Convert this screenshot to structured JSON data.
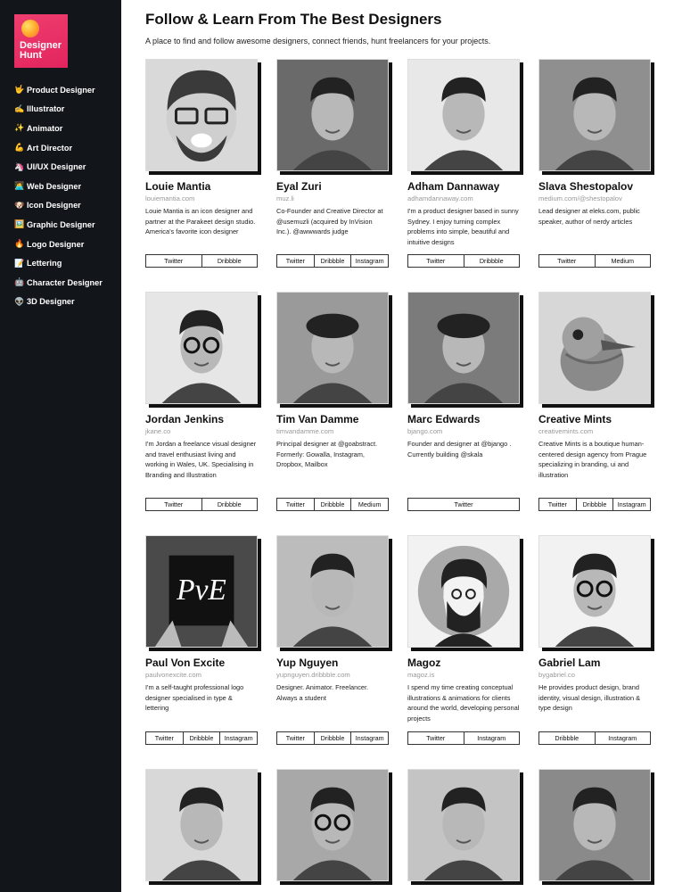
{
  "logo": {
    "line1": "Designer",
    "line2": "Hunt"
  },
  "sidebar": {
    "items": [
      {
        "icon": "🤟",
        "label": "Product Designer"
      },
      {
        "icon": "✍️",
        "label": "Illustrator"
      },
      {
        "icon": "✨",
        "label": "Animator"
      },
      {
        "icon": "💪",
        "label": "Art Director"
      },
      {
        "icon": "🦄",
        "label": "UI/UX Designer"
      },
      {
        "icon": "👩‍💻",
        "label": "Web Designer"
      },
      {
        "icon": "🐶",
        "label": "Icon Designer"
      },
      {
        "icon": "🖼️",
        "label": "Graphic Designer"
      },
      {
        "icon": "🔥",
        "label": "Logo Designer"
      },
      {
        "icon": "📝",
        "label": "Lettering"
      },
      {
        "icon": "🤖",
        "label": "Character Designer"
      },
      {
        "icon": "👽",
        "label": "3D Designer"
      }
    ]
  },
  "header": {
    "title": "Follow & Learn From The Best Designers",
    "subtitle": "A place to find and follow awesome designers, connect friends, hunt freelancers for your projects."
  },
  "designers": [
    {
      "name": "Louie Mantia",
      "site": "louiemantia.com",
      "desc": "Louie Mantia is an icon designer and partner at the Parakeet design studio. America's favorite icon designer",
      "links": [
        "Twitter",
        "Dribbble"
      ]
    },
    {
      "name": "Eyal Zuri",
      "site": "muz.li",
      "desc": "Co-Founder and Creative Director at @usemuzli (acquired by InVision Inc.). @awwwards judge",
      "links": [
        "Twitter",
        "Dribbble",
        "Instagram"
      ]
    },
    {
      "name": "Adham Dannaway",
      "site": "adhamdannaway.com",
      "desc": "I'm a product designer based in sunny Sydney. I enjoy turning complex problems into simple, beautiful and intuitive designs",
      "links": [
        "Twitter",
        "Dribbble"
      ]
    },
    {
      "name": "Slava Shestopalov",
      "site": "medium.com/@shestopalov",
      "desc": "Lead designer at eleks.com, public speaker, author of nerdy articles",
      "links": [
        "Twitter",
        "Medium"
      ]
    },
    {
      "name": "Jordan Jenkins",
      "site": "jkane.co",
      "desc": "I'm Jordan a freelance visual designer and travel enthusiast living and working in Wales, UK. Specialising in Branding and Illustration",
      "links": [
        "Twitter",
        "Dribbble"
      ]
    },
    {
      "name": "Tim Van Damme",
      "site": "timvandamme.com",
      "desc": "Principal designer at @goabstract. Formerly: Gowalla, Instagram, Dropbox, Mailbox",
      "links": [
        "Twitter",
        "Dribbble",
        "Medium"
      ]
    },
    {
      "name": "Marc Edwards",
      "site": "bjango.com",
      "desc": "Founder and designer at @bjango . Currently building @skala",
      "links": [
        "Twitter"
      ]
    },
    {
      "name": "Creative Mints",
      "site": "creativemints.com",
      "desc": "Creative Mints is a boutique human-centered design agency from Prague specializing in branding, ui and illustration",
      "links": [
        "Twitter",
        "Dribbble",
        "Instagram"
      ]
    },
    {
      "name": "Paul Von Excite",
      "site": "paulvonexcite.com",
      "desc": "I'm a self-taught professional logo designer specialised in type & lettering",
      "links": [
        "Twitter",
        "Dribbble",
        "Instagram"
      ]
    },
    {
      "name": "Yup Nguyen",
      "site": "yupnguyen.dribbble.com",
      "desc": "Designer. Animator. Freelancer. Always a student",
      "links": [
        "Twitter",
        "Dribbble",
        "Instagram"
      ]
    },
    {
      "name": "Magoz",
      "site": "magoz.is",
      "desc": "I spend my time creating conceptual illustrations & animations for clients around the world, developing personal projects",
      "links": [
        "Twitter",
        "Instagram"
      ]
    },
    {
      "name": "Gabriel Lam",
      "site": "bygabriel.co",
      "desc": "He provides product design, brand identity, visual design, illustration & type design",
      "links": [
        "Dribbble",
        "Instagram"
      ]
    },
    {
      "name": "",
      "site": "",
      "desc": "",
      "links": []
    },
    {
      "name": "",
      "site": "",
      "desc": "",
      "links": []
    },
    {
      "name": "",
      "site": "",
      "desc": "",
      "links": []
    },
    {
      "name": "",
      "site": "",
      "desc": "",
      "links": []
    }
  ]
}
